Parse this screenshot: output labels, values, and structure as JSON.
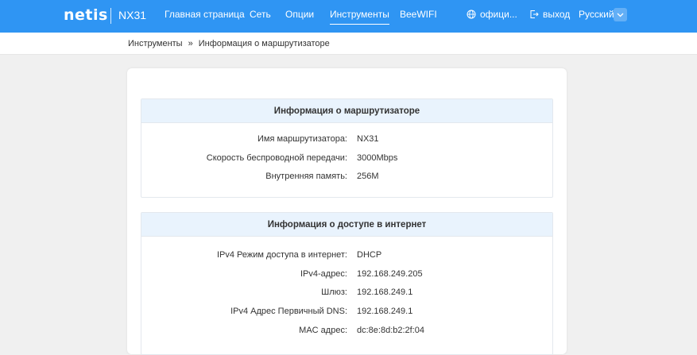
{
  "header": {
    "logo": "netis",
    "model": "NX31",
    "nav": [
      {
        "label": "Главная страница"
      },
      {
        "label": "Сеть"
      },
      {
        "label": "Опции"
      },
      {
        "label": "Инструменты"
      },
      {
        "label": "BeeWIFI"
      }
    ],
    "active_nav": "Инструменты",
    "official_label": "офици...",
    "logout_label": "выход",
    "language": "Русский"
  },
  "breadcrumb": {
    "parent": "Инструменты",
    "separator": "»",
    "current": "Информация о маршрутизаторе"
  },
  "router_info": {
    "title": "Информация о маршрутизаторе",
    "rows": [
      {
        "label": "Имя маршрутизатора:",
        "value": "NX31"
      },
      {
        "label": "Скорость беспроводной передачи:",
        "value": "3000Mbps"
      },
      {
        "label": "Внутренняя память:",
        "value": "256M"
      }
    ]
  },
  "internet_info": {
    "title": "Информация о доступе в интернет",
    "rows": [
      {
        "label": "IPv4 Режим доступа в интернет:",
        "value": "DHCP"
      },
      {
        "label": "IPv4-адрес:",
        "value": "192.168.249.205"
      },
      {
        "label": "Шлюз:",
        "value": "192.168.249.1"
      },
      {
        "label": "IPv4 Адрес Первичный DNS:",
        "value": "192.168.249.1"
      },
      {
        "label": "MAC адрес:",
        "value": "dc:8e:8d:b2:2f:04"
      }
    ]
  },
  "colors": {
    "header_bg": "#2f95f3",
    "section_head_bg": "#e9f3fd",
    "page_bg": "#f0f0f0"
  }
}
